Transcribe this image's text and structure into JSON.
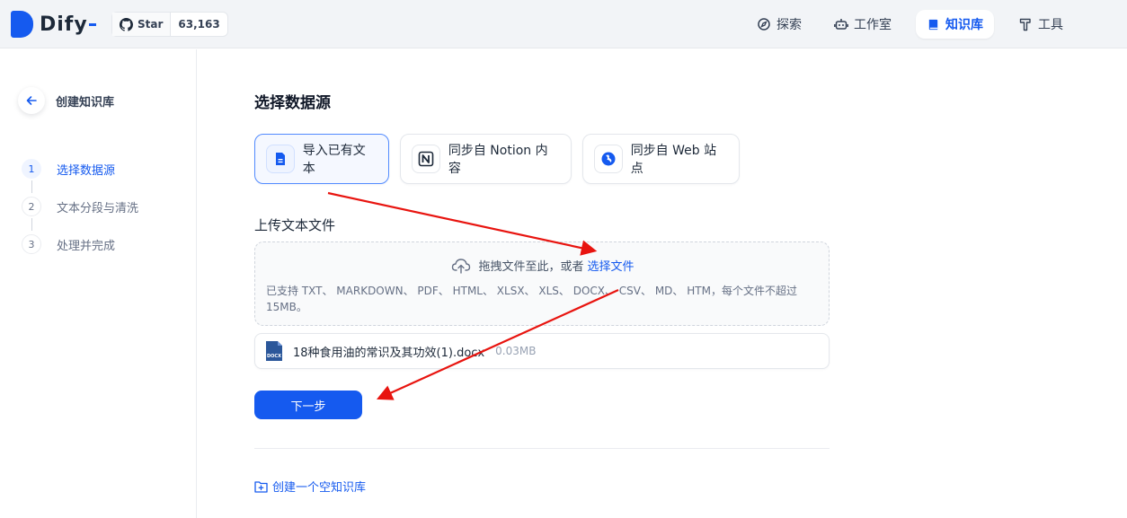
{
  "header": {
    "logo_text": "Dify",
    "github": {
      "star_label": "Star",
      "count": "63,163"
    },
    "nav": [
      {
        "label": "探索",
        "icon": "compass-icon"
      },
      {
        "label": "工作室",
        "icon": "robot-icon"
      },
      {
        "label": "知识库",
        "icon": "book-icon",
        "active": true
      },
      {
        "label": "工具",
        "icon": "hammer-icon"
      }
    ]
  },
  "sidebar": {
    "title": "创建知识库",
    "steps": [
      {
        "num": "1",
        "label": "选择数据源",
        "active": true
      },
      {
        "num": "2",
        "label": "文本分段与清洗"
      },
      {
        "num": "3",
        "label": "处理并完成"
      }
    ]
  },
  "main": {
    "title": "选择数据源",
    "sources": [
      {
        "label": "导入已有文本",
        "icon": "file-text-icon",
        "active": true
      },
      {
        "label": "同步自 Notion 内容",
        "icon": "notion-icon"
      },
      {
        "label": "同步自 Web 站点",
        "icon": "web-icon"
      }
    ],
    "upload_label": "上传文本文件",
    "dropzone": {
      "text": "拖拽文件至此，或者",
      "link": "选择文件",
      "hint": "已支持 TXT、 MARKDOWN、 PDF、 HTML、 XLSX、 XLS、 DOCX、 CSV、 MD、 HTM，每个文件不超过 15MB。"
    },
    "file": {
      "name": "18种食用油的常识及其功效(1).docx",
      "size": "0.03MB",
      "icon_label": "DOCX"
    },
    "next_button": "下一步",
    "empty_link": "创建一个空知识库"
  },
  "colors": {
    "accent": "#155aef",
    "annotation_arrow": "#e8140f"
  }
}
